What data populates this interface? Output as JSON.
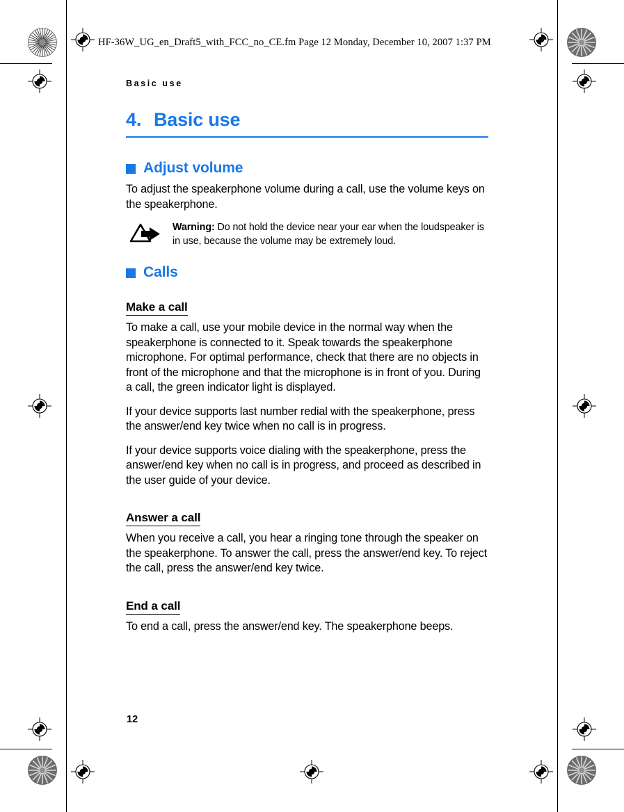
{
  "file_stamp": "HF-36W_UG_en_Draft5_with_FCC_no_CE.fm  Page 12  Monday, December 10, 2007  1:37 PM",
  "running_head": "Basic use",
  "chapter": {
    "number": "4.",
    "title": "Basic use"
  },
  "page_number": "12",
  "colors": {
    "accent_blue": "#1878e8",
    "text_black": "#000000",
    "page_background": "#ffffff"
  },
  "sections": [
    {
      "id": "adjust-volume",
      "heading": "Adjust volume",
      "paragraphs": [
        "To adjust the speakerphone volume during a call, use the volume keys on the speakerphone."
      ],
      "warning": {
        "label": "Warning:",
        "text": "Do not hold the device near your ear when the loudspeaker is in use, because the volume may be extremely loud.",
        "icon": "warning-triangle-arrow-icon"
      }
    },
    {
      "id": "calls",
      "heading": "Calls",
      "subsections": [
        {
          "id": "make-a-call",
          "heading": "Make a call",
          "paragraphs": [
            "To make a call, use your mobile device in the normal way when the speakerphone is connected to it. Speak towards the speakerphone microphone. For optimal performance, check that there are no objects in front of the microphone and that the microphone is in front of you. During a call, the green indicator light is displayed.",
            "If your device supports last number redial with the speakerphone, press the answer/end key twice when no call is in progress.",
            "If your device supports voice dialing with the speakerphone, press the answer/end key when no call is in progress, and proceed as described in the user guide of your device."
          ]
        },
        {
          "id": "answer-a-call",
          "heading": "Answer a call",
          "paragraphs": [
            "When you receive a call, you hear a ringing tone through the speaker on the speakerphone. To answer the call, press the answer/end key. To reject the call, press the answer/end key twice."
          ]
        },
        {
          "id": "end-a-call",
          "heading": "End a call",
          "paragraphs": [
            "To end a call, press the answer/end key. The speakerphone beeps."
          ]
        }
      ]
    }
  ]
}
